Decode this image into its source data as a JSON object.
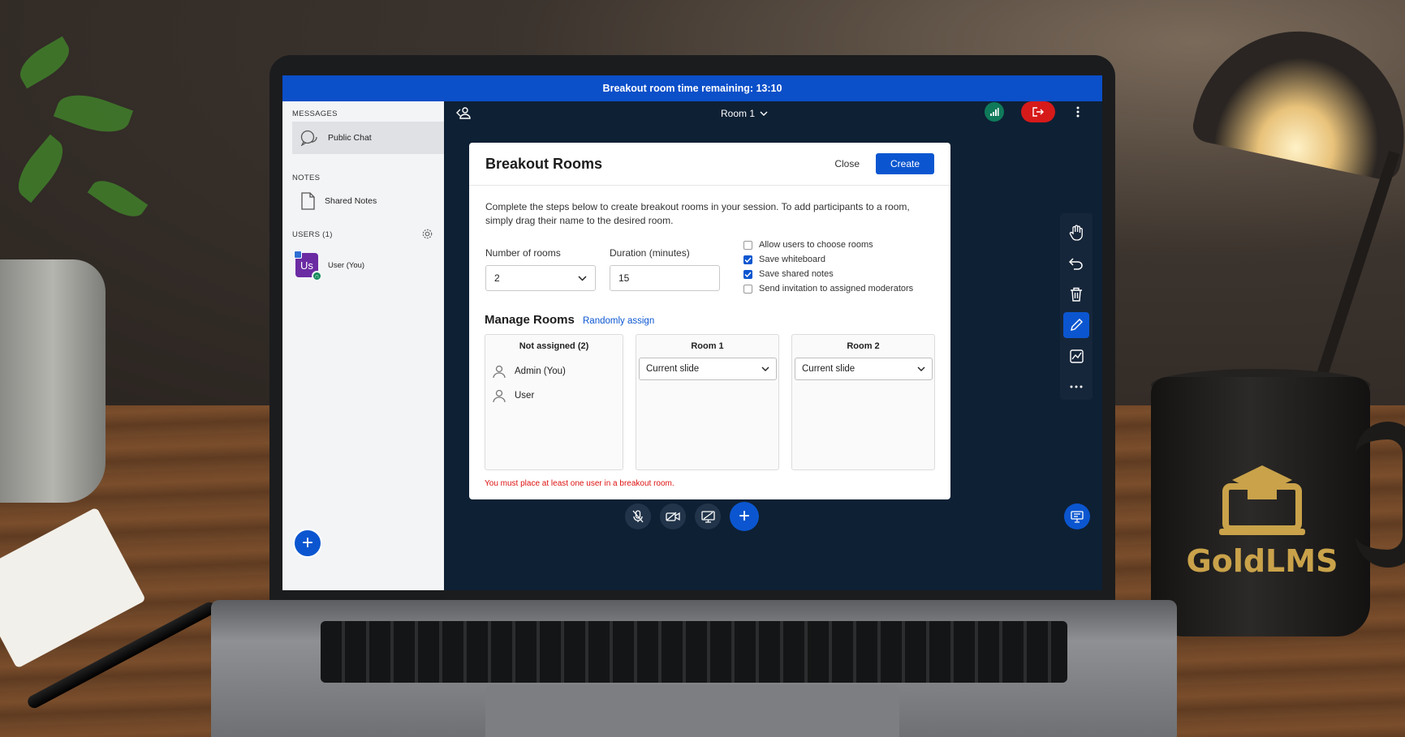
{
  "timer": {
    "text": "Breakout room time remaining: 13:10"
  },
  "sidebar": {
    "messages_header": "MESSAGES",
    "public_chat": "Public Chat",
    "notes_header": "NOTES",
    "shared_notes": "Shared Notes",
    "users_header": "USERS (1)",
    "user_avatar_initials": "Us",
    "user_name": "User (You)"
  },
  "topbar": {
    "room_label": "Room 1"
  },
  "modal": {
    "title": "Breakout Rooms",
    "close_label": "Close",
    "create_label": "Create",
    "intro": "Complete the steps below to create breakout rooms in your session. To add participants to a room, simply drag their name to the desired room.",
    "rooms_label": "Number of rooms",
    "rooms_value": "2",
    "duration_label": "Duration (minutes)",
    "duration_value": "15",
    "options": [
      {
        "label": "Allow users to choose rooms",
        "checked": false
      },
      {
        "label": "Save whiteboard",
        "checked": true
      },
      {
        "label": "Save shared notes",
        "checked": true
      },
      {
        "label": "Send invitation to assigned moderators",
        "checked": false
      }
    ],
    "manage_title": "Manage Rooms",
    "random_assign": "Randomly assign",
    "columns": {
      "unassigned": {
        "title": "Not assigned (2)",
        "users": [
          "Admin (You)",
          "User"
        ]
      },
      "room1": {
        "title": "Room 1",
        "select": "Current slide"
      },
      "room2": {
        "title": "Room 2",
        "select": "Current slide"
      }
    },
    "error": "You must place at least one user in a breakout room."
  },
  "mug": {
    "brand": "GoldLMS"
  },
  "colors": {
    "accent": "#0b56d0",
    "leave": "#d61a1a",
    "stats": "#0f7a5a",
    "error": "#dd1111"
  }
}
